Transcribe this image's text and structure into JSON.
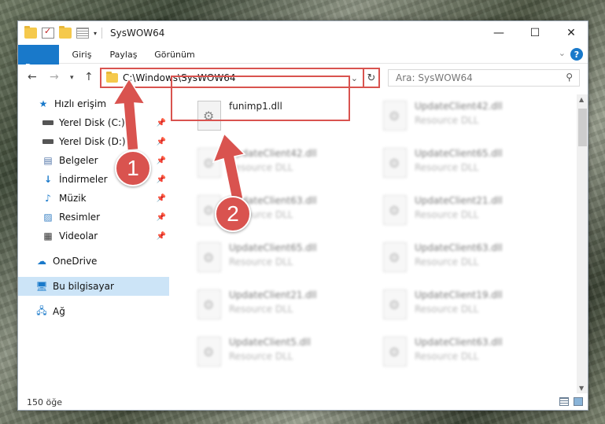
{
  "window": {
    "title": "SysWOW64",
    "minimize": "—",
    "maximize": "☐",
    "close": "✕"
  },
  "ribbon": {
    "tabs": [
      "Dosya",
      "Giriş",
      "Paylaş",
      "Görünüm"
    ],
    "help": "?"
  },
  "address": {
    "path": "C:\\Windows\\SysWOW64",
    "search_placeholder": "Ara: SysWOW64"
  },
  "nav": {
    "quick_access": "Hızlı erişim",
    "items": [
      "Yerel Disk (C:)",
      "Yerel Disk (D:)",
      "Belgeler",
      "İndirmeler",
      "Müzik",
      "Resimler",
      "Videolar"
    ],
    "onedrive": "OneDrive",
    "this_pc": "Bu bilgisayar",
    "network": "Ağ"
  },
  "files": [
    {
      "name": "funimp1.dll",
      "type": ""
    },
    {
      "name": "UpdateClient42.dll",
      "type": "Resource DLL"
    },
    {
      "name": "UpdateClient42.dll",
      "type": "Resource DLL"
    },
    {
      "name": "UpdateClient65.dll",
      "type": "Resource DLL"
    },
    {
      "name": "UpdateClient63.dll",
      "type": "Resource DLL"
    },
    {
      "name": "UpdateClient21.dll",
      "type": "Resource DLL"
    },
    {
      "name": "UpdateClient65.dll",
      "type": "Resource DLL"
    },
    {
      "name": "UpdateClient63.dll",
      "type": "Resource DLL"
    },
    {
      "name": "UpdateClient21.dll",
      "type": "Resource DLL"
    },
    {
      "name": "UpdateClient19.dll",
      "type": "Resource DLL"
    },
    {
      "name": "UpdateClient5.dll",
      "type": "Resource DLL"
    },
    {
      "name": "UpdateClient63.dll",
      "type": "Resource DLL"
    }
  ],
  "status": {
    "count": "150 öğe"
  },
  "callouts": [
    "1",
    "2"
  ],
  "colors": {
    "accent": "#1979ca",
    "highlight": "#d9534f",
    "selection": "#cce4f7"
  }
}
